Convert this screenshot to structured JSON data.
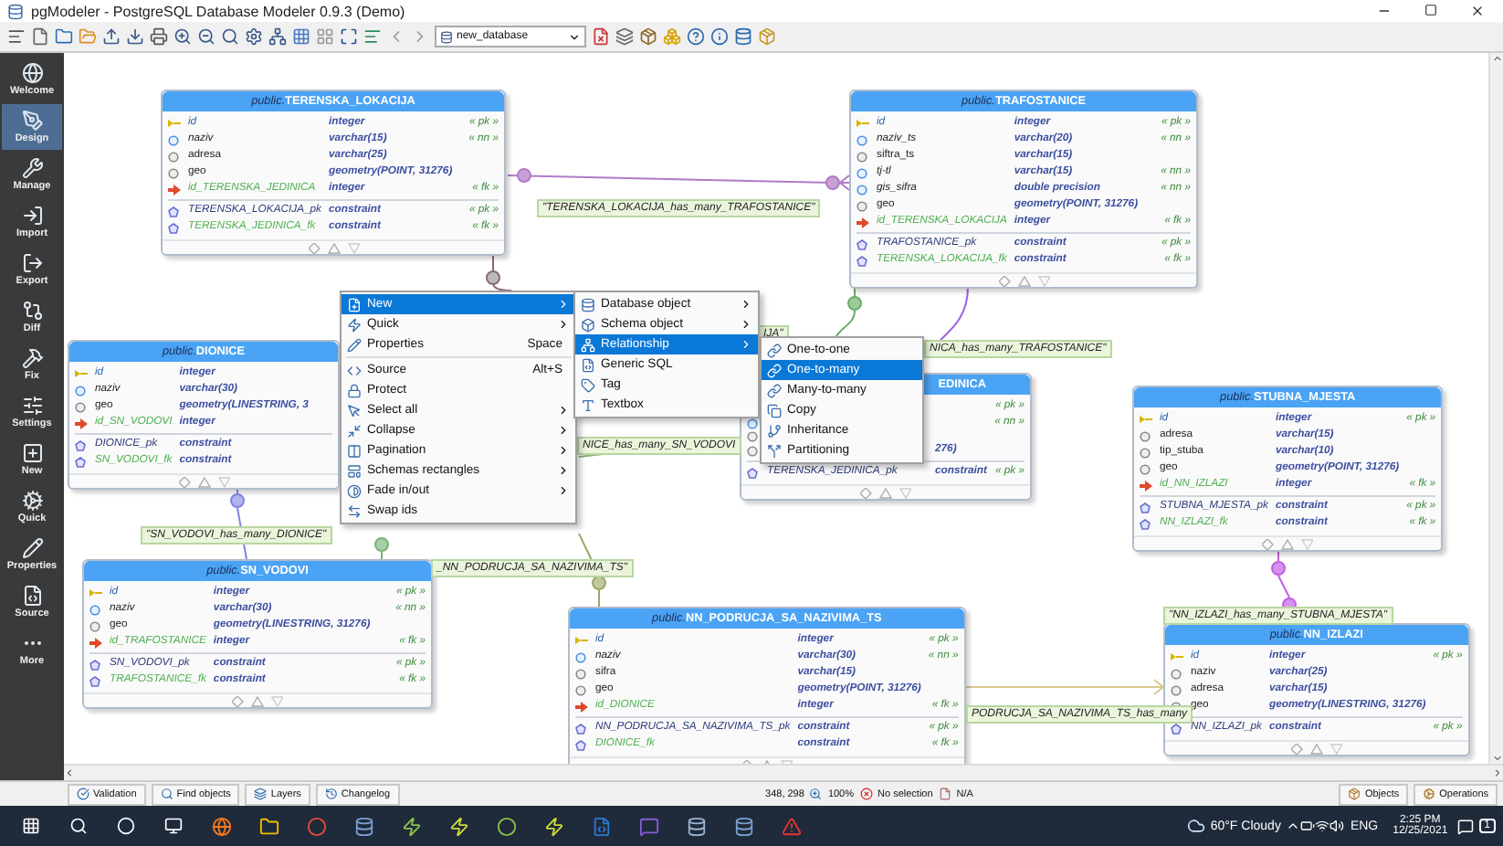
{
  "window": {
    "title": "pgModeler - PostgreSQL Database Modeler 0.9.3 (Demo)"
  },
  "toolbar": {
    "database": "new_database"
  },
  "sidebar": {
    "items": [
      {
        "label": "Welcome",
        "selected": false
      },
      {
        "label": "Design",
        "selected": true
      },
      {
        "label": "Manage",
        "selected": false
      },
      {
        "label": "Import",
        "selected": false
      },
      {
        "label": "Export",
        "selected": false
      },
      {
        "label": "Diff",
        "selected": false
      },
      {
        "label": "Fix",
        "selected": false
      },
      {
        "label": "Settings",
        "selected": false
      },
      {
        "label": "New",
        "selected": false
      },
      {
        "label": "Quick",
        "selected": false
      },
      {
        "label": "Properties",
        "selected": false
      },
      {
        "label": "Source",
        "selected": false
      },
      {
        "label": "More",
        "selected": false
      }
    ]
  },
  "tables": [
    {
      "schema": "public.",
      "name": "TERENSKA_LOKACIJA",
      "columns": [
        {
          "kind": "pk",
          "name": "id",
          "type": "integer",
          "badge": "« pk »"
        },
        {
          "kind": "nn",
          "name": "naziv",
          "type": "varchar(15)",
          "badge": "« nn »"
        },
        {
          "kind": "col",
          "name": "adresa",
          "type": "varchar(25)"
        },
        {
          "kind": "col",
          "name": "geo",
          "type": "geometry(POINT, 31276)"
        },
        {
          "kind": "fk",
          "name": "id_TERENSKA_JEDINICA",
          "type": "integer",
          "badge": "« fk »"
        }
      ],
      "constraints": [
        {
          "kind": "pk",
          "name": "TERENSKA_LOKACIJA_pk",
          "type": "constraint",
          "badge": "« pk »"
        },
        {
          "kind": "fk",
          "name": "TERENSKA_JEDINICA_fk",
          "type": "constraint",
          "badge": "« fk »"
        }
      ]
    },
    {
      "schema": "public.",
      "name": "TRAFOSTANICE",
      "columns": [
        {
          "kind": "pk",
          "name": "id",
          "type": "integer",
          "badge": "« pk »"
        },
        {
          "kind": "nn",
          "name": "naziv_ts",
          "type": "varchar(20)",
          "badge": "« nn »"
        },
        {
          "kind": "col",
          "name": "siftra_ts",
          "type": "varchar(15)"
        },
        {
          "kind": "nn",
          "name": "tj-tl",
          "type": "varchar(15)",
          "badge": "« nn »"
        },
        {
          "kind": "nn",
          "name": "gis_sifra",
          "type": "double precision",
          "badge": "« nn »"
        },
        {
          "kind": "col",
          "name": "geo",
          "type": "geometry(POINT, 31276)"
        },
        {
          "kind": "fk",
          "name": "id_TERENSKA_LOKACIJA",
          "type": "integer",
          "badge": "« fk »"
        }
      ],
      "constraints": [
        {
          "kind": "pk",
          "name": "TRAFOSTANICE_pk",
          "type": "constraint",
          "badge": "« pk »"
        },
        {
          "kind": "fk",
          "name": "TERENSKA_LOKACIJA_fk",
          "type": "constraint",
          "badge": "« fk »"
        }
      ]
    },
    {
      "schema": "public.",
      "name": "DIONICE",
      "columns": [
        {
          "kind": "pk",
          "name": "id",
          "type": "integer"
        },
        {
          "kind": "nn",
          "name": "naziv",
          "type": "varchar(30)"
        },
        {
          "kind": "col",
          "name": "geo",
          "type": "geometry(LINESTRING, 3"
        },
        {
          "kind": "fk",
          "name": "id_SN_VODOVI",
          "type": "integer"
        }
      ],
      "constraints": [
        {
          "kind": "pk",
          "name": "DIONICE_pk",
          "type": "constraint"
        },
        {
          "kind": "fk",
          "name": "SN_VODOVI_fk",
          "type": "constraint"
        }
      ]
    },
    {
      "name": "EDINICA",
      "columns": [
        {
          "kind": "pk",
          "badge": "« pk »"
        },
        {
          "kind": "nn",
          "badge": "« nn »"
        },
        {
          "kind": "col"
        },
        {
          "kind": "col",
          "type": "276)"
        }
      ],
      "constraints": [
        {
          "kind": "pk",
          "name": "TERENSKA_JEDINICA_pk",
          "type": "constraint",
          "badge": "« pk »"
        }
      ]
    },
    {
      "schema": "public.",
      "name": "STUBNA_MJESTA",
      "columns": [
        {
          "kind": "pk",
          "name": "id",
          "type": "integer",
          "badge": "« pk »"
        },
        {
          "kind": "col",
          "name": "adresa",
          "type": "varchar(15)"
        },
        {
          "kind": "col",
          "name": "tip_stuba",
          "type": "varchar(10)"
        },
        {
          "kind": "col",
          "name": "geo",
          "type": "geometry(POINT, 31276)"
        },
        {
          "kind": "fk",
          "name": "id_NN_IZLAZI",
          "type": "integer",
          "badge": "« fk »"
        }
      ],
      "constraints": [
        {
          "kind": "pk",
          "name": "STUBNA_MJESTA_pk",
          "type": "constraint",
          "badge": "« pk »"
        },
        {
          "kind": "fk",
          "name": "NN_IZLAZI_fk",
          "type": "constraint",
          "badge": "« fk »"
        }
      ]
    },
    {
      "schema": "public.",
      "name": "SN_VODOVI",
      "columns": [
        {
          "kind": "pk",
          "name": "id",
          "type": "integer",
          "badge": "« pk »"
        },
        {
          "kind": "nn",
          "name": "naziv",
          "type": "varchar(30)",
          "badge": "« nn »"
        },
        {
          "kind": "col",
          "name": "geo",
          "type": "geometry(LINESTRING, 31276)"
        },
        {
          "kind": "fk",
          "name": "id_TRAFOSTANICE",
          "type": "integer",
          "badge": "« fk »"
        }
      ],
      "constraints": [
        {
          "kind": "pk",
          "name": "SN_VODOVI_pk",
          "type": "constraint",
          "badge": "« pk »"
        },
        {
          "kind": "fk",
          "name": "TRAFOSTANICE_fk",
          "type": "constraint",
          "badge": "« fk »"
        }
      ]
    },
    {
      "schema": "public.",
      "name": "NN_PODRUCJA_SA_NAZIVIMA_TS",
      "columns": [
        {
          "kind": "pk",
          "name": "id",
          "type": "integer",
          "badge": "« pk »"
        },
        {
          "kind": "nn",
          "name": "naziv",
          "type": "varchar(30)",
          "badge": "« nn »"
        },
        {
          "kind": "col",
          "name": "sifra",
          "type": "varchar(15)"
        },
        {
          "kind": "col",
          "name": "geo",
          "type": "geometry(POINT, 31276)"
        },
        {
          "kind": "fk",
          "name": "id_DIONICE",
          "type": "integer",
          "badge": "« fk »"
        }
      ],
      "constraints": [
        {
          "kind": "pk",
          "name": "NN_PODRUCJA_SA_NAZIVIMA_TS_pk",
          "type": "constraint",
          "badge": "« pk »"
        },
        {
          "kind": "fk",
          "name": "DIONICE_fk",
          "type": "constraint",
          "badge": "« fk »"
        }
      ]
    },
    {
      "schema": "public.",
      "name": "NN_IZLAZI",
      "columns": [
        {
          "kind": "pk",
          "name": "id",
          "type": "integer",
          "badge": "« pk »"
        },
        {
          "kind": "col",
          "name": "naziv",
          "type": "varchar(25)"
        },
        {
          "kind": "col",
          "name": "adresa",
          "type": "varchar(15)"
        },
        {
          "kind": "col",
          "name": "geo",
          "type": "geometry(LINESTRING, 31276)"
        }
      ],
      "constraints": [
        {
          "kind": "pk",
          "name": "NN_IZLAZI_pk",
          "type": "constraint",
          "badge": "« pk »"
        }
      ]
    }
  ],
  "relationship_labels": [
    "\"TERENSKA_LOKACIJA_has_many_TRAFOSTANICE\"",
    "IJA\"",
    "NICA_has_many_TRAFOSTANICE\"",
    "NICE_has_many_SN_VODOVI",
    "\"SN_VODOVI_has_many_DIONICE\"",
    "_NN_PODRUCJA_SA_NAZIVIMA_TS\"",
    "PODRUCJA_SA_NAZIVIMA_TS_has_many",
    "\"NN_IZLAZI_has_many_STUBNA_MJESTA\""
  ],
  "context_menu": {
    "groups": [
      {
        "items": [
          {
            "label": "New",
            "submenu": true,
            "selected": true
          },
          {
            "label": "Quick",
            "submenu": true,
            "selected": false
          },
          {
            "label": "Properties",
            "shortcut": "Space",
            "submenu": false,
            "selected": false
          }
        ]
      },
      {
        "items": [
          {
            "label": "Source",
            "shortcut": "Alt+S",
            "submenu": false,
            "selected": false
          },
          {
            "label": "Protect",
            "submenu": false,
            "selected": false
          },
          {
            "label": "Select all",
            "submenu": true,
            "selected": false
          },
          {
            "label": "Collapse",
            "submenu": true,
            "selected": false
          },
          {
            "label": "Pagination",
            "submenu": true,
            "selected": false
          },
          {
            "label": "Schemas rectangles",
            "submenu": true,
            "selected": false
          },
          {
            "label": "Fade in/out",
            "submenu": true,
            "selected": false
          },
          {
            "label": "Swap ids",
            "submenu": false,
            "selected": false
          }
        ]
      }
    ]
  },
  "new_submenu": {
    "items": [
      {
        "label": "Database object",
        "submenu": true,
        "selected": false
      },
      {
        "label": "Schema object",
        "submenu": true,
        "selected": false
      },
      {
        "label": "Relationship",
        "submenu": true,
        "selected": true
      },
      {
        "label": "Generic SQL",
        "submenu": false,
        "selected": false
      },
      {
        "label": "Tag",
        "submenu": false,
        "selected": false
      },
      {
        "label": "Textbox",
        "submenu": false,
        "selected": false
      }
    ]
  },
  "relationship_submenu": {
    "items": [
      {
        "label": "One-to-one",
        "selected": false
      },
      {
        "label": "One-to-many",
        "selected": true
      },
      {
        "label": "Many-to-many",
        "selected": false
      },
      {
        "label": "Copy",
        "selected": false
      },
      {
        "label": "Inheritance",
        "selected": false
      },
      {
        "label": "Partitioning",
        "selected": false
      }
    ]
  },
  "bottom_bar": {
    "buttons": [
      "Validation",
      "Find objects",
      "Layers",
      "Changelog"
    ],
    "position": "348, 298",
    "zoom": "100%",
    "selection": "No selection",
    "info": "N/A",
    "right_buttons": [
      "Objects",
      "Operations"
    ]
  },
  "taskbar": {
    "weather": "60°F Cloudy",
    "language": "ENG",
    "time": "2:25 PM",
    "date": "12/25/2021",
    "notifications": "1"
  }
}
